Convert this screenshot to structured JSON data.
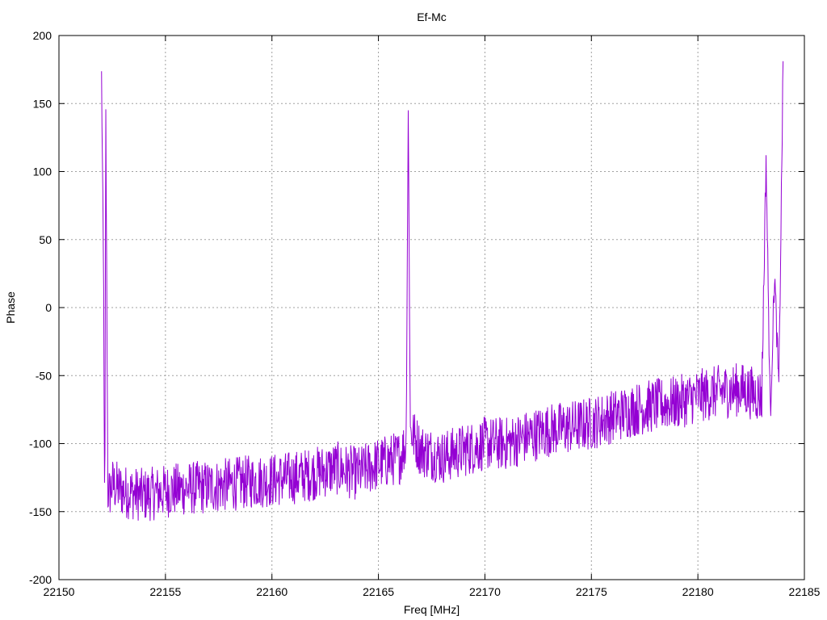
{
  "chart_data": {
    "type": "line",
    "title": "Ef-Mc",
    "xlabel": "Freq [MHz]",
    "ylabel": "Phase",
    "xlim": [
      22150,
      22185
    ],
    "ylim": [
      -200,
      200
    ],
    "xticks": [
      22150,
      22155,
      22160,
      22165,
      22170,
      22175,
      22180,
      22185
    ],
    "yticks": [
      -200,
      -150,
      -100,
      -50,
      0,
      50,
      100,
      150,
      200
    ],
    "xtick_labels": [
      "22150",
      "22155",
      "22160",
      "22165",
      "22170",
      "22175",
      "22180",
      "22185"
    ],
    "ytick_labels": [
      "-200",
      "-150",
      "-100",
      "-50",
      "0",
      "50",
      "100",
      "150",
      "200"
    ],
    "grid": true,
    "series": [
      {
        "color": "#9400d3",
        "x_range": [
          22152,
          22184
        ],
        "trend": [
          [
            22152.0,
            170
          ],
          [
            22152.1,
            10
          ],
          [
            22152.15,
            -175
          ],
          [
            22152.2,
            140
          ],
          [
            22152.3,
            -140
          ],
          [
            22152.5,
            -130
          ],
          [
            22153.0,
            -135
          ],
          [
            22154.0,
            -138
          ],
          [
            22155.0,
            -135
          ],
          [
            22156.0,
            -133
          ],
          [
            22157.0,
            -132
          ],
          [
            22158.0,
            -130
          ],
          [
            22159.0,
            -128
          ],
          [
            22160.0,
            -127
          ],
          [
            22161.0,
            -125
          ],
          [
            22162.0,
            -122
          ],
          [
            22163.0,
            -118
          ],
          [
            22164.0,
            -122
          ],
          [
            22165.0,
            -115
          ],
          [
            22166.0,
            -110
          ],
          [
            22166.3,
            -100
          ],
          [
            22166.4,
            145
          ],
          [
            22166.5,
            -90
          ],
          [
            22167.0,
            -105
          ],
          [
            22168.0,
            -110
          ],
          [
            22169.0,
            -105
          ],
          [
            22170.0,
            -100
          ],
          [
            22171.0,
            -100
          ],
          [
            22172.0,
            -95
          ],
          [
            22173.0,
            -90
          ],
          [
            22174.0,
            -88
          ],
          [
            22175.0,
            -85
          ],
          [
            22176.0,
            -80
          ],
          [
            22177.0,
            -75
          ],
          [
            22178.0,
            -72
          ],
          [
            22179.0,
            -70
          ],
          [
            22180.0,
            -65
          ],
          [
            22181.0,
            -62
          ],
          [
            22182.0,
            -60
          ],
          [
            22183.0,
            -65
          ],
          [
            22183.2,
            110
          ],
          [
            22183.4,
            -80
          ],
          [
            22183.6,
            25
          ],
          [
            22183.8,
            -60
          ],
          [
            22184.0,
            178
          ]
        ],
        "noise_amplitude": 20
      }
    ]
  },
  "colors": {
    "series": "#9400d3",
    "grid": "#a0a0a0",
    "axis": "#000000",
    "background": "#ffffff"
  }
}
